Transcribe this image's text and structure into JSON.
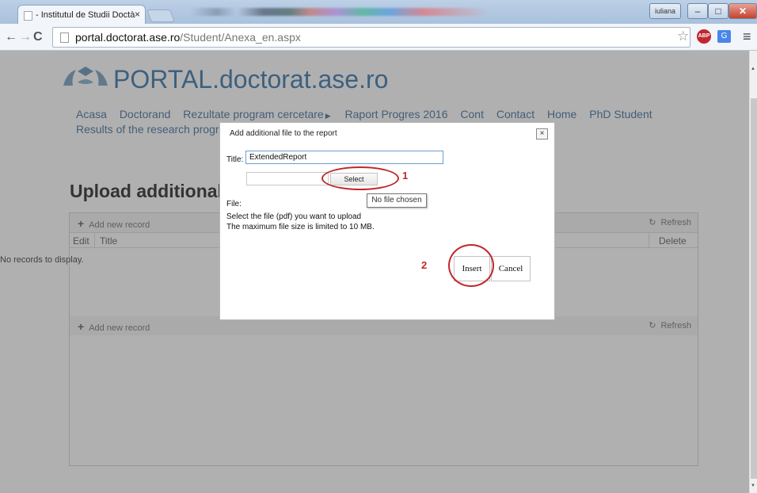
{
  "browser": {
    "tab_title": "- Institutul de Studii Doctà",
    "tab_close": "×",
    "user_badge": "iuliana",
    "url_host": "portal.doctorat.ase.ro",
    "url_path": "/Student/Anexa_en.aspx",
    "abp_label": "ABP"
  },
  "site": {
    "title": "PORTAL.doctorat.ase.ro",
    "nav_items": [
      "Acasa",
      "Doctorand",
      "Rezultate program cercetare",
      "Raport Progres 2016",
      "Cont",
      "Contact",
      "Home",
      "PhD Student"
    ],
    "nav_second_line": "Results of the research progra",
    "heading": "Upload additional fil"
  },
  "grid": {
    "add_label": "Add new record",
    "refresh_label": "Refresh",
    "columns": [
      "Edit",
      "Title",
      "Delete"
    ],
    "empty_text": "No records to display."
  },
  "dialog": {
    "title": "Add additional file to the report",
    "close": "×",
    "title_label": "Title:",
    "title_value": "ExtendedReport",
    "select_label": "Select",
    "tooltip": "No file chosen",
    "file_label": "File:",
    "hint_line1": "Select the file (pdf) you want to upload",
    "hint_line2": "The maximum file size is limited to 10 MB.",
    "insert_label": "Insert",
    "cancel_label": "Cancel"
  },
  "annotations": {
    "step1": "1",
    "step2": "2",
    "color": "#c0282d"
  }
}
